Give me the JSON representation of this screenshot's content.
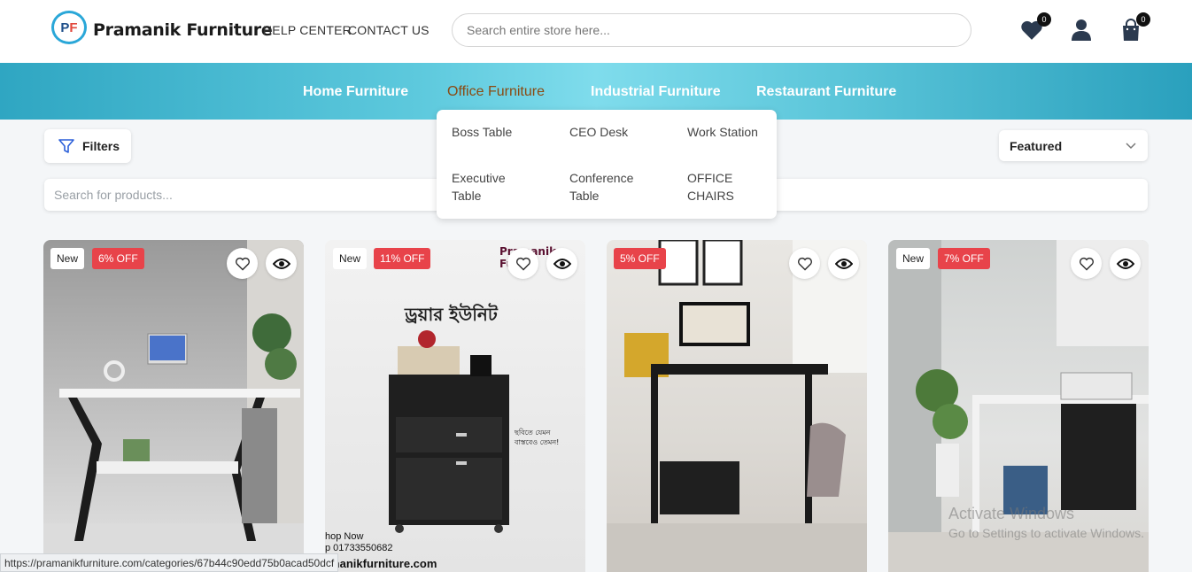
{
  "header": {
    "brand": "Pramanik Furniture",
    "links": [
      "HELP CENTER",
      "CONTACT US"
    ],
    "search_placeholder": "Search entire store here...",
    "wishlist_count": "0",
    "cart_count": "0"
  },
  "nav": {
    "items": [
      "Home Furniture",
      "Office Furniture",
      "Industrial Furniture",
      "Restaurant Furniture"
    ],
    "active": "Office Furniture"
  },
  "dropdown": {
    "items": [
      "Boss Table",
      "CEO Desk",
      "Work Station",
      "Executive Table",
      "Conference Table",
      "OFFICE CHAIRS"
    ]
  },
  "toolbar": {
    "filters_label": "Filters",
    "sort_value": "Featured",
    "product_search_placeholder": "Search for products..."
  },
  "products": [
    {
      "new_label": "New",
      "discount": "6% OFF"
    },
    {
      "new_label": "New",
      "discount": "11% OFF",
      "image_text": {
        "brand": "Pramanik Furnit",
        "title": "ড্রয়ার ইউনিট",
        "note_line1": "ছবিতে যেমন",
        "note_line2": "বাস্তবেও তেমন!",
        "shop": "hop Now",
        "phone": "p 01733550682",
        "site": "rmanikfurniture.com"
      }
    },
    {
      "discount": "5% OFF"
    },
    {
      "new_label": "New",
      "discount": "7% OFF"
    }
  ],
  "status_url": "https://pramanikfurniture.com/categories/67b44c90edd75b0acad50dcf",
  "watermark": {
    "line1": "Activate Windows",
    "line2": "Go to Settings to activate Windows."
  },
  "colors": {
    "nav_gradient_mid": "#7fdcec",
    "active_nav": "#8a4a12",
    "discount": "#e8434a"
  }
}
